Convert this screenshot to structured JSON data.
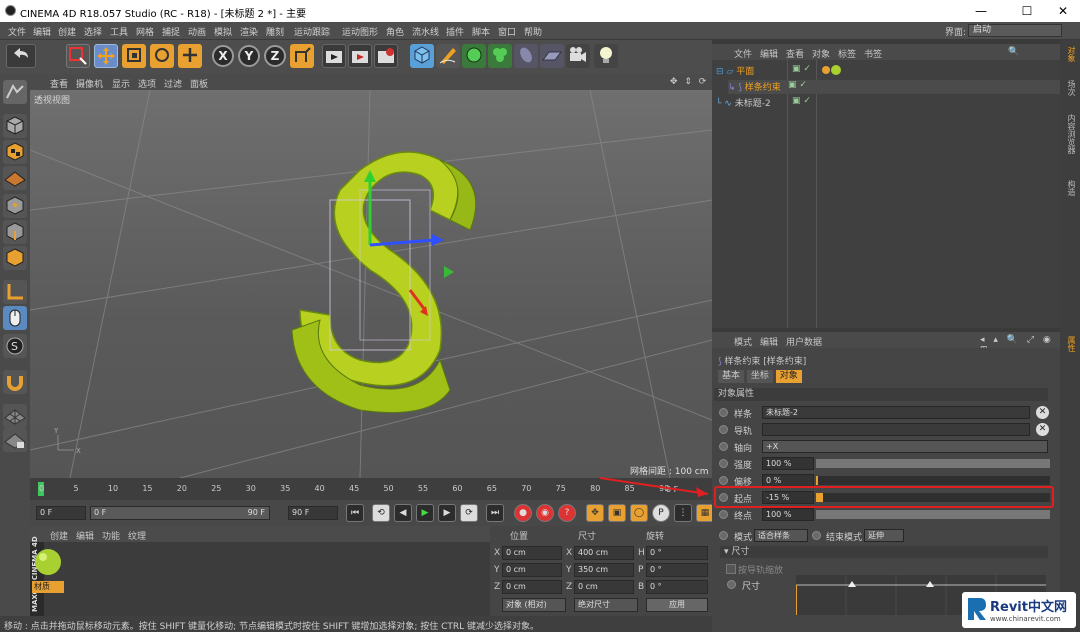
{
  "window": {
    "title": "CINEMA 4D R18.057 Studio (RC - R18) - [未标题 2 *] - 主要",
    "min": "—",
    "max": "☐",
    "close": "✕"
  },
  "menubar": {
    "items": [
      "文件",
      "编辑",
      "创建",
      "选择",
      "工具",
      "网格",
      "捕捉",
      "动画",
      "模拟",
      "渲染",
      "雕刻",
      "运动跟踪",
      "运动图形",
      "角色",
      "流水线",
      "插件",
      "脚本",
      "窗口",
      "帮助"
    ],
    "layout_label": "界面:",
    "layout_value": "启动"
  },
  "toolbar": {
    "x": "X",
    "y": "Y",
    "z": "Z"
  },
  "viewport": {
    "menu": [
      "查看",
      "摄像机",
      "显示",
      "选项",
      "过滤",
      "面板"
    ],
    "label": "透视视图",
    "grid_label": "网格间距 : 100 cm"
  },
  "timeline": {
    "ticks": [
      "0",
      "5",
      "10",
      "15",
      "20",
      "25",
      "30",
      "35",
      "40",
      "45",
      "50",
      "55",
      "60",
      "65",
      "70",
      "75",
      "80",
      "85",
      "90"
    ],
    "end_frame": "0 F"
  },
  "transport": {
    "start": "0 F",
    "current": "0 F",
    "range_end": "90 F",
    "end": "90 F"
  },
  "materials": {
    "menu": [
      "创建",
      "编辑",
      "功能",
      "纹理"
    ],
    "item_label": "材质"
  },
  "coords": {
    "headers": [
      "位置",
      "尺寸",
      "旋转"
    ],
    "rows": [
      {
        "axis": "X",
        "pos": "0 cm",
        "size_axis": "X",
        "size": "400 cm",
        "rot_axis": "H",
        "rot": "0 °"
      },
      {
        "axis": "Y",
        "pos": "0 cm",
        "size_axis": "Y",
        "size": "350 cm",
        "rot_axis": "P",
        "rot": "0 °"
      },
      {
        "axis": "Z",
        "pos": "0 cm",
        "size_axis": "Z",
        "size": "0 cm",
        "rot_axis": "B",
        "rot": "0 °"
      }
    ],
    "mode1": "对象 (相对)",
    "mode2": "绝对尺寸",
    "apply": "应用"
  },
  "status": "移动 : 点击并拖动鼠标移动元素。按住 SHIFT 键量化移动; 节点编辑模式时按住 SHIFT 键增加选择对象; 按住 CTRL 键减少选择对象。",
  "object_manager": {
    "menu": [
      "文件",
      "编辑",
      "查看",
      "对象",
      "标签",
      "书签"
    ],
    "objects": [
      "平面",
      "样条约束",
      "未标题-2"
    ]
  },
  "right_tabs": [
    "对象",
    "场次",
    "内容浏览器",
    "构造"
  ],
  "attr_right_tabs": [
    "属性"
  ],
  "attributes": {
    "menu": [
      "模式",
      "编辑",
      "用户数据"
    ],
    "object_title": "样条约束 [样条约束]",
    "tabs": [
      "基本",
      "坐标",
      "对象"
    ],
    "section": "对象属性",
    "spline_label": "样条",
    "spline_value": "未标题-2",
    "guide_label": "导轨",
    "axis_label": "轴向",
    "axis_value": "+X",
    "strength_label": "强度",
    "strength_value": "100 %",
    "offset_label": "偏移",
    "offset_value": "0 %",
    "start_label": "起点",
    "start_value": "-15 %",
    "end_label": "终点",
    "end_value": "100 %",
    "mode_label": "模式",
    "mode_value": "适合样条",
    "endmode_label": "结束模式",
    "endmode_value": "延伸",
    "size_section": "尺寸",
    "size_checkbox": "按导轨缩放",
    "size_label": "尺寸",
    "strength_level": 1.0,
    "start_level": 0.03,
    "end_level": 1.0
  },
  "watermark": {
    "brand": "Revit中文网",
    "url": "www.chinarevit.com"
  },
  "colors": {
    "highlight_red": "#e02020",
    "accent_orange": "#f0a020",
    "object_yellow": "#c8e020"
  }
}
